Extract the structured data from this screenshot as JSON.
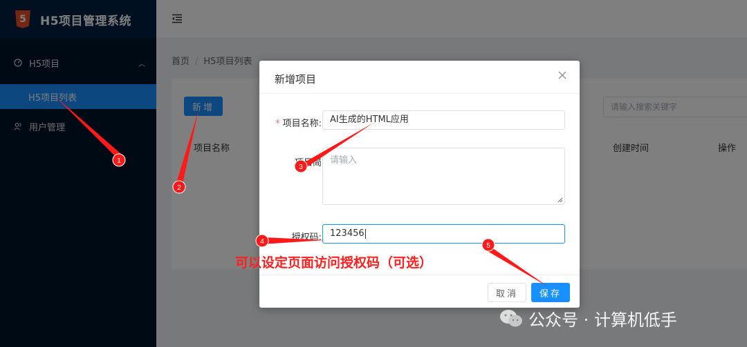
{
  "app": {
    "title": "H5项目管理系统",
    "logo_glyph": "5"
  },
  "sidebar": {
    "group_label": "H5项目",
    "active_item": "H5项目列表",
    "user_item": "用户管理"
  },
  "breadcrumb": {
    "home": "首页",
    "separator": "/",
    "current": "H5项目列表"
  },
  "toolbar": {
    "add_label": "新增",
    "search_placeholder": "请输入搜索关键字"
  },
  "table": {
    "headers": [
      "项目名称",
      "创建时间",
      "操作"
    ]
  },
  "dialog": {
    "title": "新增项目",
    "required_mark": "*",
    "name_label": "项目名称:",
    "name_value": "AI生成的HTML应用",
    "desc_label": "项目简",
    "desc_placeholder": "请输入",
    "auth_label": "授权码:",
    "auth_value": "123456",
    "cancel_label": "取消",
    "save_label": "保存"
  },
  "annotations": {
    "markers": [
      "1",
      "2",
      "3",
      "4",
      "5"
    ],
    "callout": "可以设定页面访问授权码（可选）",
    "color": "#ff1a1a"
  },
  "watermark": {
    "text": "公众号 · 计算机低手"
  },
  "colors": {
    "primary": "#1890ff",
    "sidebar": "#001529",
    "danger": "#f56c6c"
  }
}
